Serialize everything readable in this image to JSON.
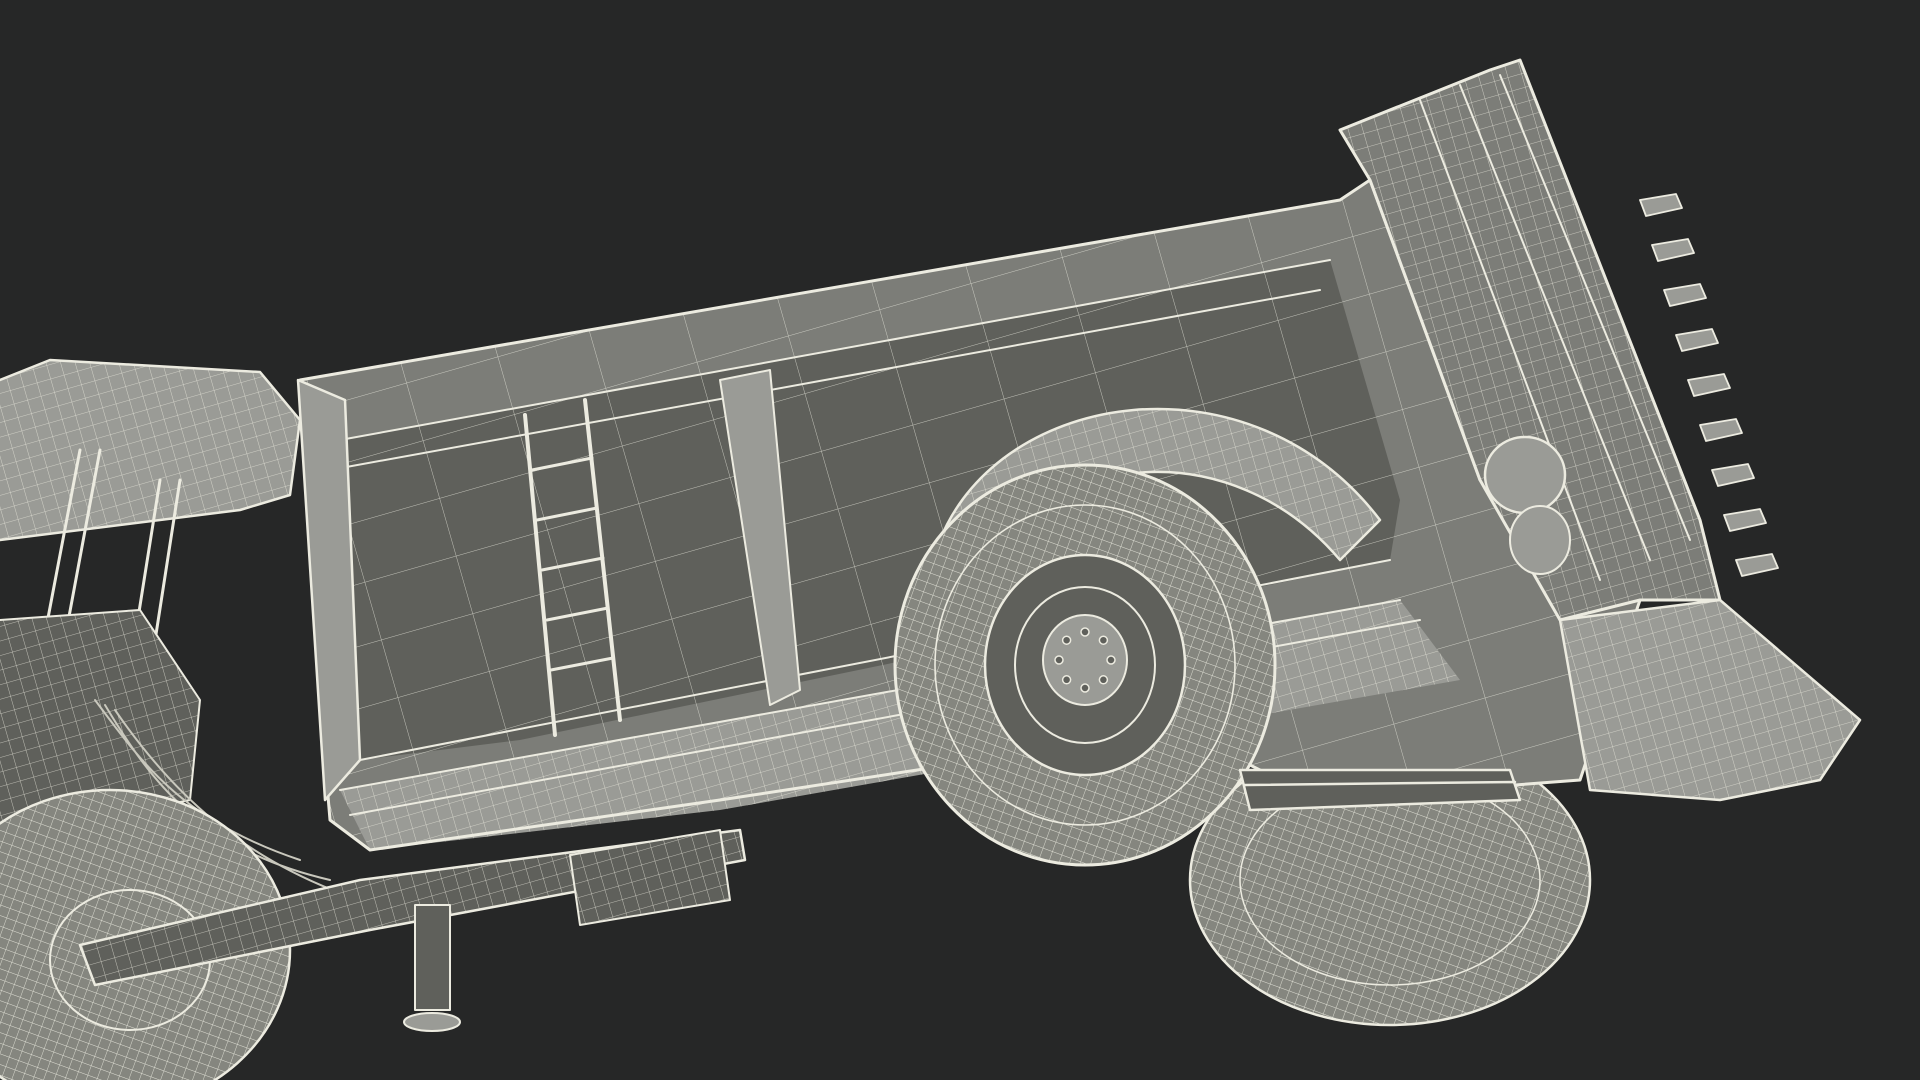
{
  "scene": {
    "subject": "wireframe-render-tractor-and-manure-spreader",
    "colors": {
      "background": "#262727",
      "body_fill": "#7c7d78",
      "body_dark": "#5f605b",
      "body_light": "#9a9b96",
      "tire_fill": "#85867f",
      "wire": "#ecebe0",
      "wire_dim": "#c9c8bd"
    }
  }
}
